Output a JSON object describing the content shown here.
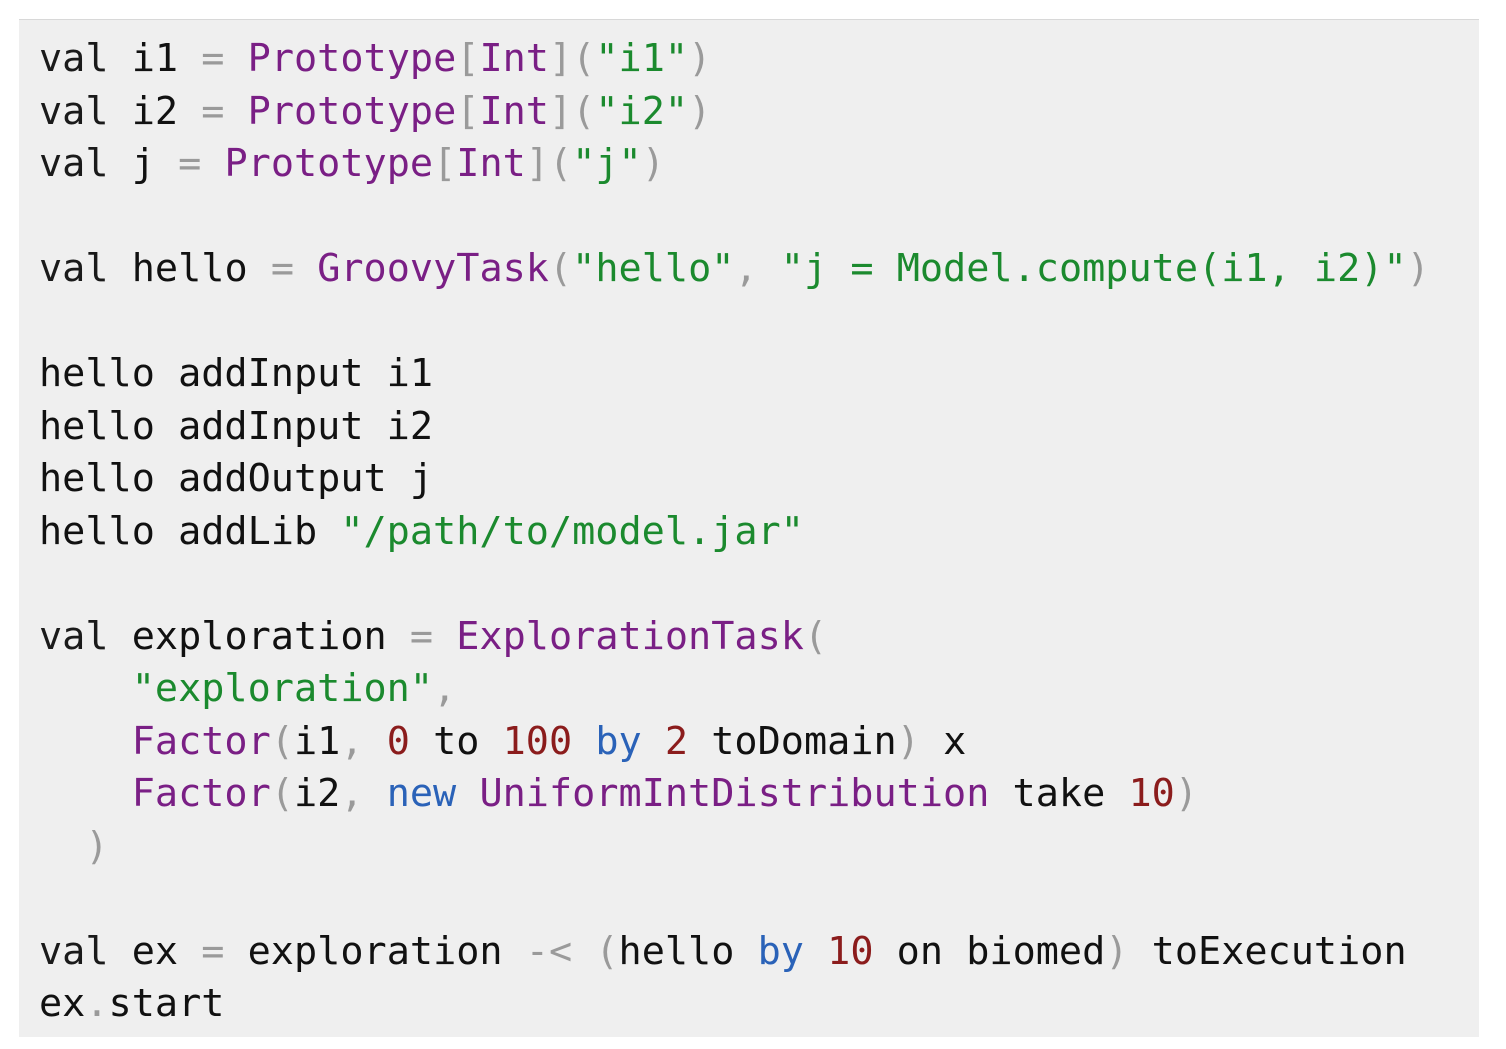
{
  "code": {
    "language": "scala",
    "lines": [
      [
        {
          "t": "val",
          "c": "kw"
        },
        {
          "t": " i1 ",
          "c": "id"
        },
        {
          "t": "=",
          "c": "pn"
        },
        {
          "t": " ",
          "c": "id"
        },
        {
          "t": "Prototype",
          "c": "ty"
        },
        {
          "t": "[",
          "c": "pn"
        },
        {
          "t": "Int",
          "c": "ty"
        },
        {
          "t": "](",
          "c": "pn"
        },
        {
          "t": "\"i1\"",
          "c": "str"
        },
        {
          "t": ")",
          "c": "pn"
        }
      ],
      [
        {
          "t": "val",
          "c": "kw"
        },
        {
          "t": " i2 ",
          "c": "id"
        },
        {
          "t": "=",
          "c": "pn"
        },
        {
          "t": " ",
          "c": "id"
        },
        {
          "t": "Prototype",
          "c": "ty"
        },
        {
          "t": "[",
          "c": "pn"
        },
        {
          "t": "Int",
          "c": "ty"
        },
        {
          "t": "](",
          "c": "pn"
        },
        {
          "t": "\"i2\"",
          "c": "str"
        },
        {
          "t": ")",
          "c": "pn"
        }
      ],
      [
        {
          "t": "val",
          "c": "kw"
        },
        {
          "t": " j ",
          "c": "id"
        },
        {
          "t": "=",
          "c": "pn"
        },
        {
          "t": " ",
          "c": "id"
        },
        {
          "t": "Prototype",
          "c": "ty"
        },
        {
          "t": "[",
          "c": "pn"
        },
        {
          "t": "Int",
          "c": "ty"
        },
        {
          "t": "](",
          "c": "pn"
        },
        {
          "t": "\"j\"",
          "c": "str"
        },
        {
          "t": ")",
          "c": "pn"
        }
      ],
      [],
      [
        {
          "t": "val",
          "c": "kw"
        },
        {
          "t": " hello ",
          "c": "id"
        },
        {
          "t": "=",
          "c": "pn"
        },
        {
          "t": " ",
          "c": "id"
        },
        {
          "t": "GroovyTask",
          "c": "ty"
        },
        {
          "t": "(",
          "c": "pn"
        },
        {
          "t": "\"hello\"",
          "c": "str"
        },
        {
          "t": ", ",
          "c": "pn"
        },
        {
          "t": "\"j = Model.compute(i1, i2)\"",
          "c": "str"
        },
        {
          "t": ")",
          "c": "pn"
        }
      ],
      [],
      [
        {
          "t": "hello addInput i1",
          "c": "id"
        }
      ],
      [
        {
          "t": "hello addInput i2",
          "c": "id"
        }
      ],
      [
        {
          "t": "hello addOutput j",
          "c": "id"
        }
      ],
      [
        {
          "t": "hello addLib ",
          "c": "id"
        },
        {
          "t": "\"/path/to/model.jar\"",
          "c": "str"
        }
      ],
      [],
      [
        {
          "t": "val",
          "c": "kw"
        },
        {
          "t": " exploration ",
          "c": "id"
        },
        {
          "t": "=",
          "c": "pn"
        },
        {
          "t": " ",
          "c": "id"
        },
        {
          "t": "ExplorationTask",
          "c": "ty"
        },
        {
          "t": "(",
          "c": "pn"
        }
      ],
      [
        {
          "t": "    ",
          "c": "id"
        },
        {
          "t": "\"exploration\"",
          "c": "str"
        },
        {
          "t": ",",
          "c": "pn"
        }
      ],
      [
        {
          "t": "    ",
          "c": "id"
        },
        {
          "t": "Factor",
          "c": "ty"
        },
        {
          "t": "(",
          "c": "pn"
        },
        {
          "t": "i1",
          "c": "id"
        },
        {
          "t": ", ",
          "c": "pn"
        },
        {
          "t": "0",
          "c": "num"
        },
        {
          "t": " to ",
          "c": "id"
        },
        {
          "t": "100",
          "c": "num"
        },
        {
          "t": " ",
          "c": "id"
        },
        {
          "t": "by",
          "c": "kb"
        },
        {
          "t": " ",
          "c": "id"
        },
        {
          "t": "2",
          "c": "num"
        },
        {
          "t": " toDomain",
          "c": "id"
        },
        {
          "t": ")",
          "c": "pn"
        },
        {
          "t": " x",
          "c": "id"
        }
      ],
      [
        {
          "t": "    ",
          "c": "id"
        },
        {
          "t": "Factor",
          "c": "ty"
        },
        {
          "t": "(",
          "c": "pn"
        },
        {
          "t": "i2",
          "c": "id"
        },
        {
          "t": ", ",
          "c": "pn"
        },
        {
          "t": "new",
          "c": "kb"
        },
        {
          "t": " ",
          "c": "id"
        },
        {
          "t": "UniformIntDistribution",
          "c": "ty"
        },
        {
          "t": " take ",
          "c": "id"
        },
        {
          "t": "10",
          "c": "num"
        },
        {
          "t": ")",
          "c": "pn"
        }
      ],
      [
        {
          "t": "  ",
          "c": "id"
        },
        {
          "t": ")",
          "c": "pn"
        }
      ],
      [],
      [
        {
          "t": "val",
          "c": "kw"
        },
        {
          "t": " ex ",
          "c": "id"
        },
        {
          "t": "=",
          "c": "pn"
        },
        {
          "t": " exploration ",
          "c": "id"
        },
        {
          "t": "-<",
          "c": "pn"
        },
        {
          "t": " ",
          "c": "id"
        },
        {
          "t": "(",
          "c": "pn"
        },
        {
          "t": "hello ",
          "c": "id"
        },
        {
          "t": "by",
          "c": "kb"
        },
        {
          "t": " ",
          "c": "id"
        },
        {
          "t": "10",
          "c": "num"
        },
        {
          "t": " on biomed",
          "c": "id"
        },
        {
          "t": ")",
          "c": "pn"
        },
        {
          "t": " toExecution",
          "c": "id"
        }
      ],
      [
        {
          "t": "ex",
          "c": "id"
        },
        {
          "t": ".",
          "c": "pn"
        },
        {
          "t": "start",
          "c": "id"
        }
      ]
    ]
  },
  "colors": {
    "background": "#efefef",
    "identifier": "#111111",
    "type": "#7a1f85",
    "string": "#1b8a2e",
    "number": "#8b1c1c",
    "keyword_blue": "#2a62b8",
    "punctuation": "#9a9a9a"
  }
}
